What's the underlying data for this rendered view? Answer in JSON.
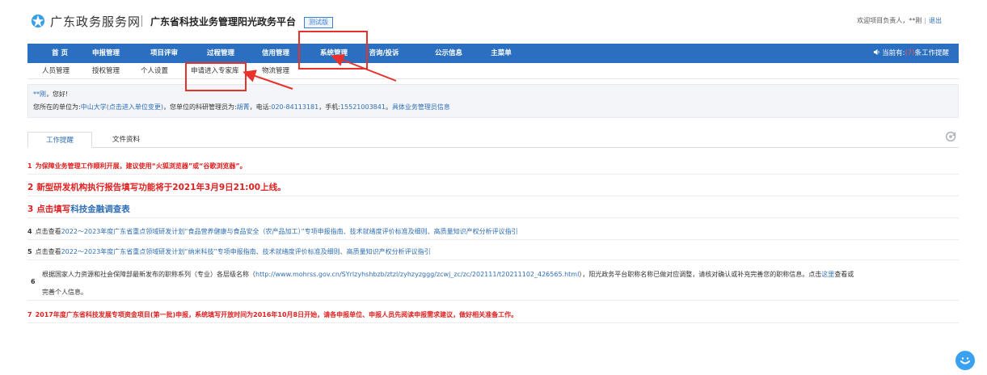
{
  "header": {
    "logo_text": "广东政务服务网",
    "platform_title": "广东省科技业务管理阳光政务平台",
    "test_badge": "测试版",
    "welcome": "欢迎项目负责人，**刚",
    "logout": "退出"
  },
  "nav": {
    "items": [
      {
        "label": "首 页"
      },
      {
        "label": "申报管理"
      },
      {
        "label": "项目评审"
      },
      {
        "label": "过程管理"
      },
      {
        "label": "信用管理"
      },
      {
        "label": "系统管理"
      },
      {
        "label": "咨询/投诉"
      },
      {
        "label": "公示信息"
      },
      {
        "label": "主菜单"
      }
    ],
    "alert_prefix": "当前有:",
    "alert_count": "(7)",
    "alert_suffix": "条工作提醒"
  },
  "subnav": {
    "items": [
      {
        "label": "人员管理"
      },
      {
        "label": "授权管理"
      },
      {
        "label": "个人设置"
      },
      {
        "label": "申请进入专家库"
      },
      {
        "label": "物流管理"
      }
    ]
  },
  "info": {
    "user_name": "**刚",
    "greeting_suffix": "，您好!",
    "unit_prefix": "您所在的单位为:",
    "unit_name": "中山大学(点击进入单位变更)",
    "admin_prefix": "，您单位的科研管理员为:",
    "admin_name": "胡菁",
    "phone_prefix": "，电话:",
    "phone": "020-84113181",
    "mobile_prefix": "，手机:",
    "mobile": "15521003841",
    "more_link": "具体业务管理员信息",
    "period": "。"
  },
  "tabs": [
    {
      "label": "工作提醒"
    },
    {
      "label": "文件资料"
    }
  ],
  "notices": {
    "n1_num": "1",
    "n1_text": "为保障业务管理工作顺利开展，建议使用“火狐浏览器”或“谷歌浏览器”。",
    "n2_num": "2",
    "n2_text": "新型研发机构执行报告填写功能将于2021年3月9日21:00上线。",
    "n3_num": "3",
    "n3_prefix": "点击填写",
    "n3_link": "科技金融调查表",
    "n4_num": "4",
    "n4_prefix": "点击查看",
    "n4_link": "2022～2023年度广东省重点领域研发计划“食品营养健康与食品安全（农产品加工）”专项申报指南、技术就绪度评价标准及细则、高质量知识产权分析评议指引",
    "n5_num": "5",
    "n5_prefix": "点击查看",
    "n5_link": "2022～2023年度广东省重点领域研发计划“纳米科技”专项申报指南、技术就绪度评价标准及细则、高质量知识产权分析评议指引",
    "n6_num": "6",
    "n6_text_a": "根据国家人力资源和社会保障部最新发布的职称系列（专业）各层级名称（",
    "n6_url": "http://www.mohrss.gov.cn/SYrlzyhshbzb/ztzl/zyhzyzggg/zcwj_zc/zc/202111/t20211102_426565.html",
    "n6_text_b": "），阳光政务平台职称名称已做对应调整，请核对确认或补充完善您的职称信息。点击",
    "n6_here": "这里",
    "n6_text_c": "查看或",
    "n6_line2": "完善个人信息。",
    "n7_num": "7",
    "n7_text": "2017年度广东省科技发展专项资金项目(第一批)申报，系统填写开放时间为2016年10月8日开始，请各申报单位、申报人员先阅读申报需求建议，做好相关准备工作。"
  },
  "colors": {
    "nav_blue": "#2b6fc0",
    "link_blue": "#2f6fb5",
    "alert_red": "#e02020",
    "annotation_red": "#e8312b"
  },
  "icons": {
    "logo": "guangdong-logo-icon",
    "refresh": "refresh-icon",
    "speaker": "speaker-icon",
    "chat": "chat-bubble-icon"
  }
}
